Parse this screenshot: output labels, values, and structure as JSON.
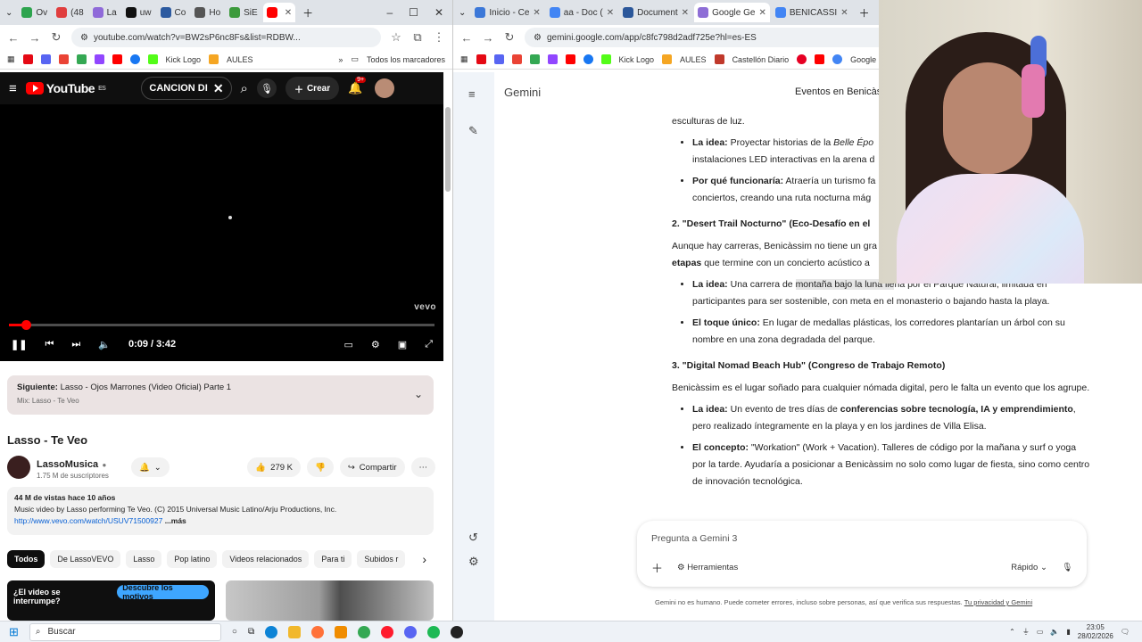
{
  "left_browser": {
    "tabs": [
      {
        "label": "Ov",
        "color": "#2da44e"
      },
      {
        "label": "(48",
        "color": "#e03e3e"
      },
      {
        "label": "La",
        "color": "#8f6ad9"
      },
      {
        "label": "uw",
        "color": "#111111"
      },
      {
        "label": "Co",
        "color": "#2c5aa0"
      },
      {
        "label": "Ho",
        "color": "#555555"
      },
      {
        "label": "SiE",
        "color": "#3c9a3c"
      },
      {
        "label": "",
        "color": "#ff0000",
        "active": true
      }
    ],
    "url": "youtube.com/watch?v=BW2sP6nc8Fs&list=RDBW...",
    "bookmarks": [
      "Kick Logo",
      "AULES",
      "Todos los marcadores"
    ]
  },
  "youtube": {
    "logo_text": "YouTube",
    "region": "ES",
    "search_value": "CANCION DI",
    "create_label": "Crear",
    "notif_count": "9+",
    "watermark": "vevo",
    "time": "0:09 / 3:42",
    "progress_fraction": 0.04,
    "next": {
      "label": "Siguiente:",
      "title": "Lasso - Ojos Marrones (Video Oficial) Parte 1",
      "sub": "Mix: Lasso - Te Veo"
    },
    "title": "Lasso - Te Veo",
    "channel": "LassoMusica",
    "subscribers": "1.75 M de suscriptores",
    "likes": "279 K",
    "share_label": "Compartir",
    "desc_meta": "44 M de vistas  hace 10 años",
    "desc_text": "Music video by Lasso performing Te Veo. (C) 2015 Universal Music Latino/Arju Productions, Inc.",
    "desc_link": "http://www.vevo.com/watch/USUV71500927",
    "desc_more": "...más",
    "chips": [
      "Todos",
      "De LassoVEVO",
      "Lasso",
      "Pop latino",
      "Videos relacionados",
      "Para ti",
      "Subidos r"
    ],
    "ad_question": "¿El video se interrumpe?",
    "ad_button": "Descubre los motivos"
  },
  "right_browser": {
    "tabs": [
      {
        "label": "Inicio - Ce",
        "color": "#3c78d8"
      },
      {
        "label": "aa - Doc (",
        "color": "#4285f4"
      },
      {
        "label": "Document",
        "color": "#2b579a"
      },
      {
        "label": "Google Ge",
        "color": "#8e6ed6",
        "active": true
      },
      {
        "label": "BENICASSI",
        "color": "#4285f4"
      }
    ],
    "url": "gemini.google.com/app/c8fc798d2adf725e?hl=es-ES",
    "bookmarks": [
      "Kick Logo",
      "AULES",
      "Castellón Diario",
      "Google"
    ]
  },
  "gemini": {
    "brand": "Gemini",
    "conversation_title": "Eventos en Benicàs",
    "intro_tail": "esculturas de luz.",
    "section1_bullets": [
      {
        "label": "La idea:",
        "text": " Proyectar historias de la ",
        "italic": "Belle Épo",
        "text2": "",
        "line2": "instalaciones LED interactivas en la arena d"
      },
      {
        "label": "Por qué funcionaría:",
        "text": " Atraería un turismo fa",
        "line2": "conciertos, creando una ruta nocturna mág"
      }
    ],
    "section2_title": "2. \"Desert Trail Nocturno\" (Eco-Desafío en el",
    "section2_intro_a": "Aunque hay carreras, Benicàssim no tiene un gra",
    "section2_intro_b_bold": "etapas",
    "section2_intro_b": " que termine con un concierto acústico a",
    "section2_bullets": [
      {
        "label": "La idea:",
        "text_a": " Una carrera de ",
        "highlight": "montaña bajo la luna lle",
        "text_b": "na por el Parque Natural, limitada en participantes para ser sostenible, con meta en el monasterio o bajando hasta la playa."
      },
      {
        "label": "El toque único:",
        "text_a": " En lugar de medallas plásticas, los corredores plantarían un árbol con su nombre en una zona degradada del parque.",
        "highlight": "",
        "text_b": ""
      }
    ],
    "section3_title": "3. \"Digital Nomad Beach Hub\" (Congreso de Trabajo Remoto)",
    "section3_intro": "Benicàssim es el lugar soñado para cualquier nómada digital, pero le falta un evento que los agrupe.",
    "section3_bullets": [
      {
        "label": "La idea:",
        "text_a": " Un evento de tres días de ",
        "bold": "conferencias sobre tecnología, IA y emprendimiento",
        "text_b": ", pero realizado íntegramente en la playa y en los jardines de Villa Elisa."
      },
      {
        "label": "El concepto:",
        "text_a": " \"Workation\" (Work + Vacation). Talleres de código por la mañana y surf o yoga por la tarde. Ayudaría a posicionar a Benicàssim no solo como lugar de fiesta, sino como centro de innovación tecnológica.",
        "bold": "",
        "text_b": ""
      }
    ],
    "input_placeholder": "Pregunta a Gemini 3",
    "tools_label": "Herramientas",
    "mode_label": "Rápido",
    "disclaimer": "Gemini no es humano. Puede cometer errores, incluso sobre personas, así que verifica sus respuestas.",
    "disclaimer_link": "Tu privacidad y Gemini"
  },
  "taskbar": {
    "search_placeholder": "Buscar",
    "time": "23:05",
    "date": "28/02/2026"
  }
}
